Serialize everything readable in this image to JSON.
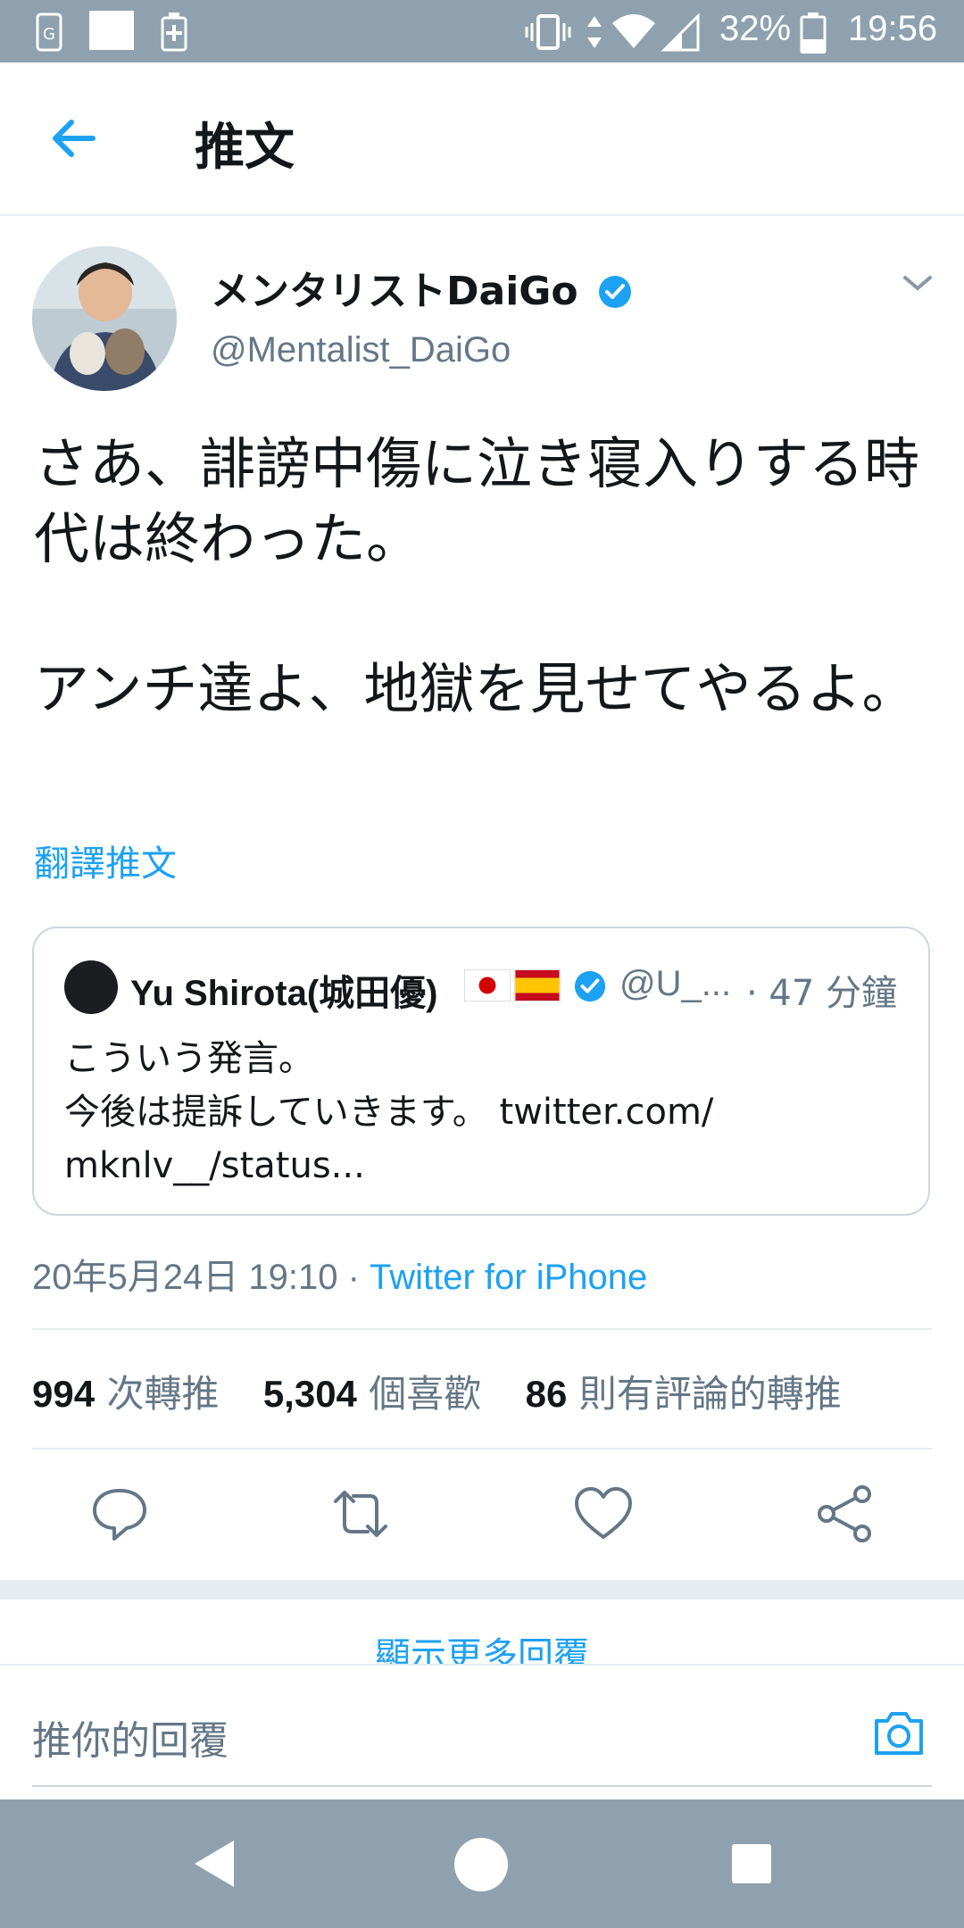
{
  "status_bar": {
    "battery_percent": "32%",
    "time": "19:56"
  },
  "app_bar": {
    "title": "推文"
  },
  "tweet": {
    "author_name": "メンタリストDaiGo",
    "author_handle": "@Mentalist_DaiGo",
    "verified": true,
    "paragraphs": [
      "さあ、誹謗中傷に泣き寝入りする時代は終わった。",
      "アンチ達よ、地獄を見せてやるよ。"
    ],
    "translate_label": "翻譯推文",
    "timestamp": "20年5月24日 19:10",
    "separator": " · ",
    "source": "Twitter for iPhone"
  },
  "quoted_tweet": {
    "name": "Yu Shirota(城田優)",
    "handle": "@U_...",
    "time": "· 47 分鐘",
    "line1": "こういう発言。",
    "line2": "今後は提訴していきます。 twitter.com/",
    "line3": "mknlv__/status..."
  },
  "stats": {
    "retweets_count": "994",
    "retweets_label": "次轉推",
    "likes_count": "5,304",
    "likes_label": "個喜歡",
    "quotes_count": "86",
    "quotes_label": "則有評論的轉推"
  },
  "actions": [
    "reply",
    "retweet",
    "like",
    "share"
  ],
  "show_more_label": "顯示更多回覆",
  "reply": {
    "placeholder": "推你的回覆"
  },
  "colors": {
    "accent": "#1da1f2",
    "secondary_text": "#657786",
    "status_bar": "#8fa1ae",
    "divider": "#e6ecf0"
  }
}
